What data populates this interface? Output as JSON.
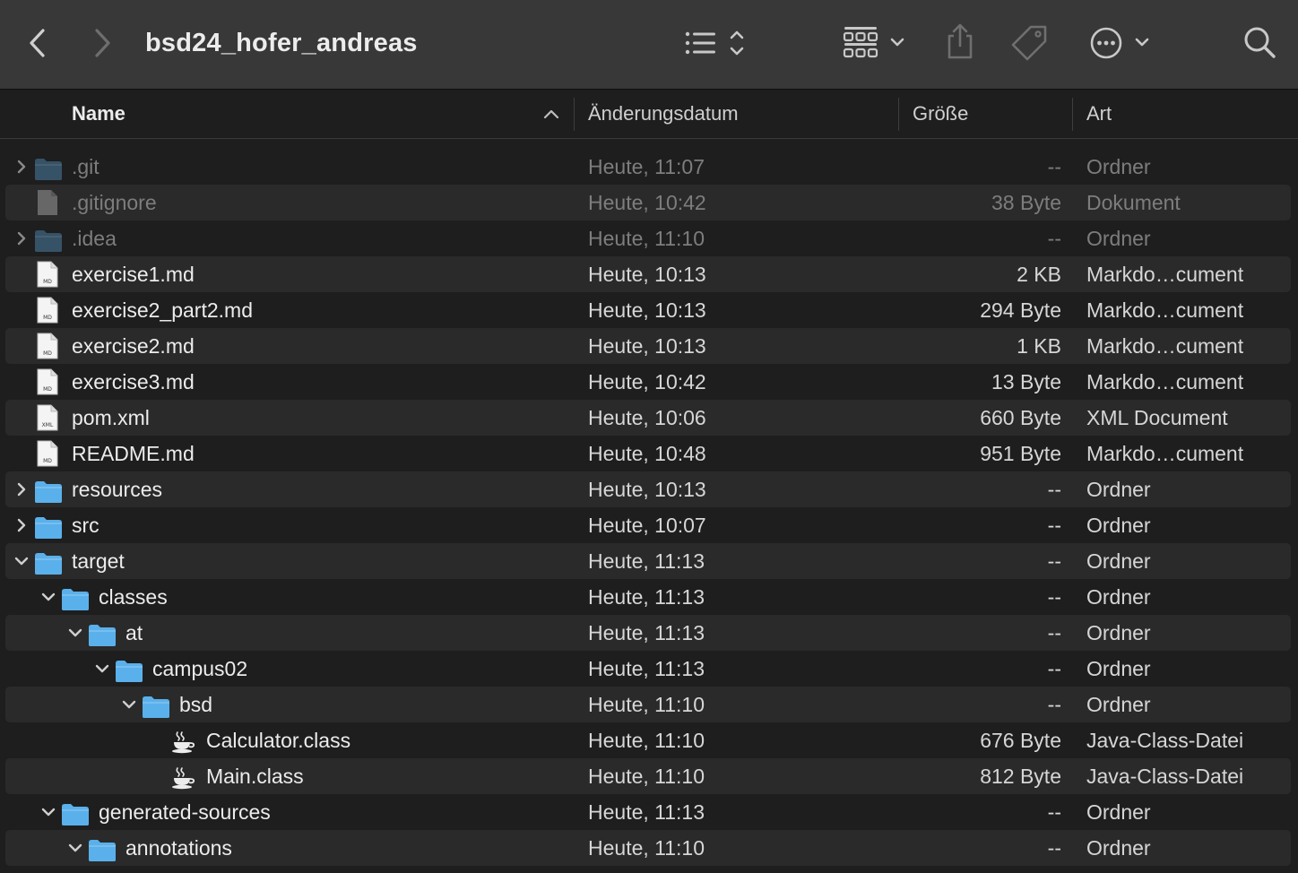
{
  "window": {
    "title": "bsd24_hofer_andreas"
  },
  "toolbar": {
    "back_icon": "chevron-left-icon",
    "forward_icon": "chevron-right-icon",
    "list_view_icon": "list-view-icon",
    "group_icon": "grid-group-icon",
    "share_icon": "share-icon",
    "tag_icon": "tag-icon",
    "more_icon": "ellipsis-circle-icon",
    "search_icon": "search-icon"
  },
  "columns": {
    "name": "Name",
    "date": "Änderungsdatum",
    "size": "Größe",
    "kind": "Art",
    "sort": "ascending"
  },
  "colors": {
    "folder": "#5ab0ea",
    "folder_dim": "#4a7ea3",
    "background": "#1e1e1e",
    "toolbar": "#383838"
  },
  "files": [
    {
      "name": ".git",
      "date": "Heute, 11:07",
      "size": "--",
      "kind": "Ordner",
      "icon": "folder",
      "depth": 0,
      "disclosure": "closed",
      "hidden": true
    },
    {
      "name": ".gitignore",
      "date": "Heute, 10:42",
      "size": "38 Byte",
      "kind": "Dokument",
      "icon": "document",
      "depth": 0,
      "disclosure": "none",
      "hidden": true
    },
    {
      "name": ".idea",
      "date": "Heute, 11:10",
      "size": "--",
      "kind": "Ordner",
      "icon": "folder",
      "depth": 0,
      "disclosure": "closed",
      "hidden": true
    },
    {
      "name": "exercise1.md",
      "date": "Heute, 10:13",
      "size": "2 KB",
      "kind": "Markdo…cument",
      "icon": "md-file",
      "file_badge": "MD",
      "depth": 0,
      "disclosure": "none"
    },
    {
      "name": "exercise2_part2.md",
      "date": "Heute, 10:13",
      "size": "294 Byte",
      "kind": "Markdo…cument",
      "icon": "md-file",
      "file_badge": "MD",
      "depth": 0,
      "disclosure": "none"
    },
    {
      "name": "exercise2.md",
      "date": "Heute, 10:13",
      "size": "1 KB",
      "kind": "Markdo…cument",
      "icon": "md-file",
      "file_badge": "MD",
      "depth": 0,
      "disclosure": "none"
    },
    {
      "name": "exercise3.md",
      "date": "Heute, 10:42",
      "size": "13 Byte",
      "kind": "Markdo…cument",
      "icon": "md-file",
      "file_badge": "MD",
      "depth": 0,
      "disclosure": "none"
    },
    {
      "name": "pom.xml",
      "date": "Heute, 10:06",
      "size": "660 Byte",
      "kind": "XML Document",
      "icon": "xml-file",
      "file_badge": "XML",
      "depth": 0,
      "disclosure": "none"
    },
    {
      "name": "README.md",
      "date": "Heute, 10:48",
      "size": "951 Byte",
      "kind": "Markdo…cument",
      "icon": "md-file",
      "file_badge": "MD",
      "depth": 0,
      "disclosure": "none"
    },
    {
      "name": "resources",
      "date": "Heute, 10:13",
      "size": "--",
      "kind": "Ordner",
      "icon": "folder",
      "depth": 0,
      "disclosure": "closed"
    },
    {
      "name": "src",
      "date": "Heute, 10:07",
      "size": "--",
      "kind": "Ordner",
      "icon": "folder",
      "depth": 0,
      "disclosure": "closed"
    },
    {
      "name": "target",
      "date": "Heute, 11:13",
      "size": "--",
      "kind": "Ordner",
      "icon": "folder",
      "depth": 0,
      "disclosure": "open"
    },
    {
      "name": "classes",
      "date": "Heute, 11:13",
      "size": "--",
      "kind": "Ordner",
      "icon": "folder",
      "depth": 1,
      "disclosure": "open"
    },
    {
      "name": "at",
      "date": "Heute, 11:13",
      "size": "--",
      "kind": "Ordner",
      "icon": "folder",
      "depth": 2,
      "disclosure": "open"
    },
    {
      "name": "campus02",
      "date": "Heute, 11:13",
      "size": "--",
      "kind": "Ordner",
      "icon": "folder",
      "depth": 3,
      "disclosure": "open"
    },
    {
      "name": "bsd",
      "date": "Heute, 11:10",
      "size": "--",
      "kind": "Ordner",
      "icon": "folder",
      "depth": 4,
      "disclosure": "open"
    },
    {
      "name": "Calculator.class",
      "date": "Heute, 11:10",
      "size": "676 Byte",
      "kind": "Java-Class-Datei",
      "icon": "java-class",
      "depth": 5,
      "disclosure": "none"
    },
    {
      "name": "Main.class",
      "date": "Heute, 11:10",
      "size": "812 Byte",
      "kind": "Java-Class-Datei",
      "icon": "java-class",
      "depth": 5,
      "disclosure": "none"
    },
    {
      "name": "generated-sources",
      "date": "Heute, 11:13",
      "size": "--",
      "kind": "Ordner",
      "icon": "folder",
      "depth": 1,
      "disclosure": "open"
    },
    {
      "name": "annotations",
      "date": "Heute, 11:10",
      "size": "--",
      "kind": "Ordner",
      "icon": "folder",
      "depth": 2,
      "disclosure": "open"
    }
  ]
}
